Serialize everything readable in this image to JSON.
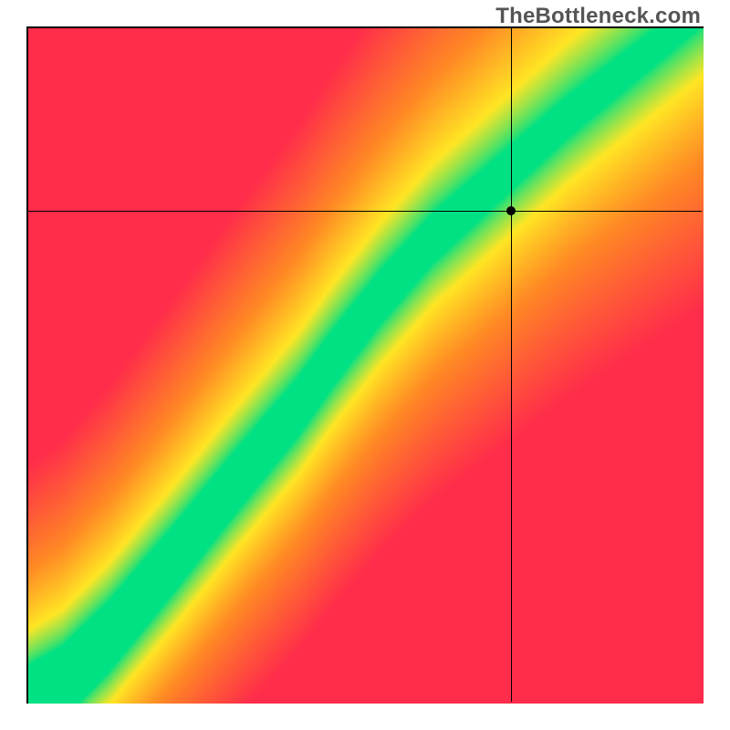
{
  "watermark": "TheBottleneck.com",
  "colors": {
    "green": "#00e184",
    "yellow": "#ffe625",
    "orange": "#ff8a24",
    "red": "#ff2c4b"
  },
  "chart_data": {
    "type": "heatmap",
    "title": "",
    "xlabel": "",
    "ylabel": "",
    "xlim": [
      0,
      100
    ],
    "ylim": [
      0,
      100
    ],
    "grid": false,
    "legend": false,
    "marker": {
      "x": 71.5,
      "y": 73
    },
    "crosshair": {
      "x": 71.5,
      "y": 73
    },
    "ridge": [
      {
        "x": 0,
        "y": 0
      },
      {
        "x": 5,
        "y": 3
      },
      {
        "x": 12,
        "y": 10
      },
      {
        "x": 22,
        "y": 22
      },
      {
        "x": 30,
        "y": 32
      },
      {
        "x": 40,
        "y": 44
      },
      {
        "x": 45,
        "y": 51
      },
      {
        "x": 52,
        "y": 60
      },
      {
        "x": 60,
        "y": 69
      },
      {
        "x": 70,
        "y": 78
      },
      {
        "x": 80,
        "y": 87
      },
      {
        "x": 90,
        "y": 95
      },
      {
        "x": 100,
        "y": 103
      }
    ],
    "plateau_half_width": 4,
    "falloff_scale": 40,
    "note": "Color encodes match quality: green = ideal along the ridge, yellow → orange → red with increasing distance. Values are read off pixel positions; axes carry no tick labels."
  }
}
